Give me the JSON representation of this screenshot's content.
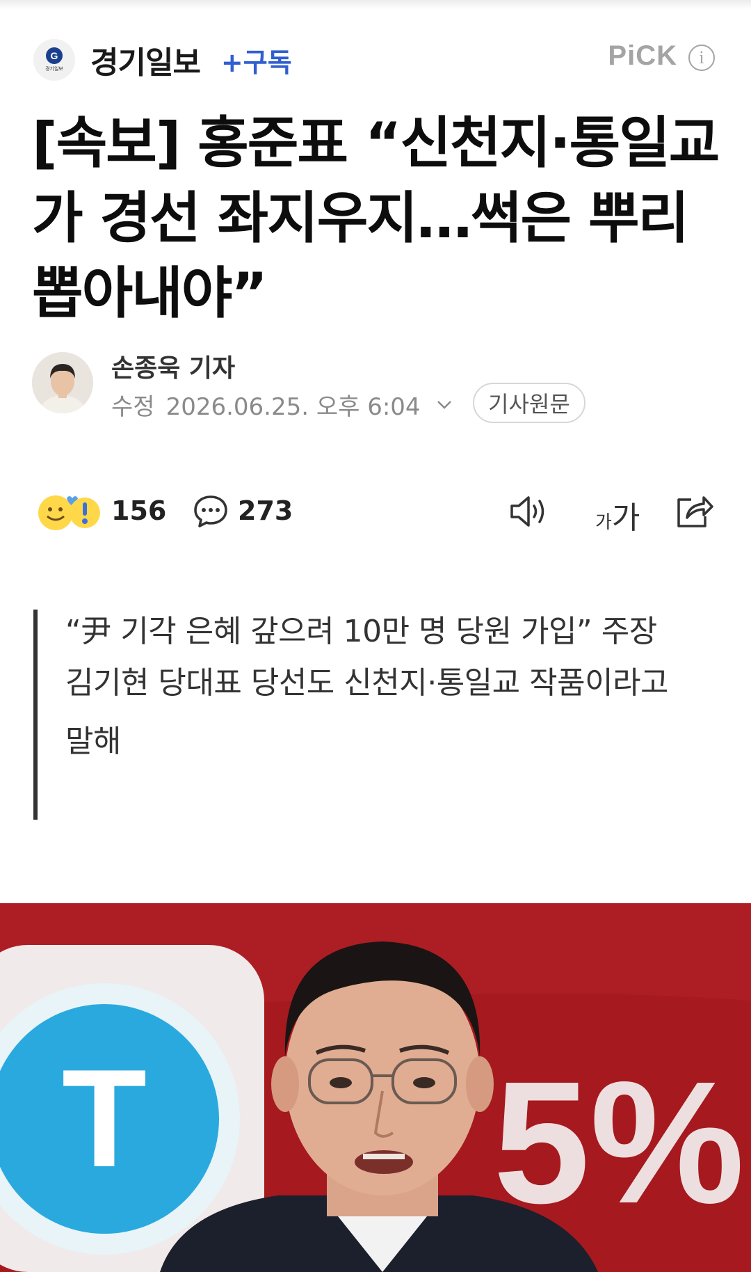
{
  "press": {
    "name": "경기일보",
    "logo_text": "경기일보",
    "subscribe_label": "+구독",
    "pick_label": "PiCK",
    "info_icon": "info-icon"
  },
  "article": {
    "headline": "[속보] 홍준표 “신천지·통일교가 경선 좌지우지…썩은 뿌리 뽑아내야”",
    "reporter": "손종욱 기자",
    "modified_label": "수정",
    "modified_date": "2026.06.25. 오후 6:04",
    "origin_button": "기사원문"
  },
  "actions": {
    "reaction_count": "156",
    "comment_count": "273",
    "font_size_small": "가",
    "font_size_large": "가",
    "icons": [
      "reaction-emoji-icon",
      "comment-icon",
      "speaker-icon",
      "font-size-icon",
      "share-icon"
    ]
  },
  "summary": {
    "line1": "“尹 기각 은혜 갚으려 10만 명 당원 가입” 주장",
    "line2": "김기현 당대표 당선도 신천지·통일교 작품이라고 말해"
  },
  "photo": {
    "sign_letter": "T",
    "sign_percent": "5%"
  },
  "colors": {
    "accent_blue": "#2f5fd0",
    "photo_background_red": "#a6191e",
    "pick_gray": "#a4a4a4"
  }
}
